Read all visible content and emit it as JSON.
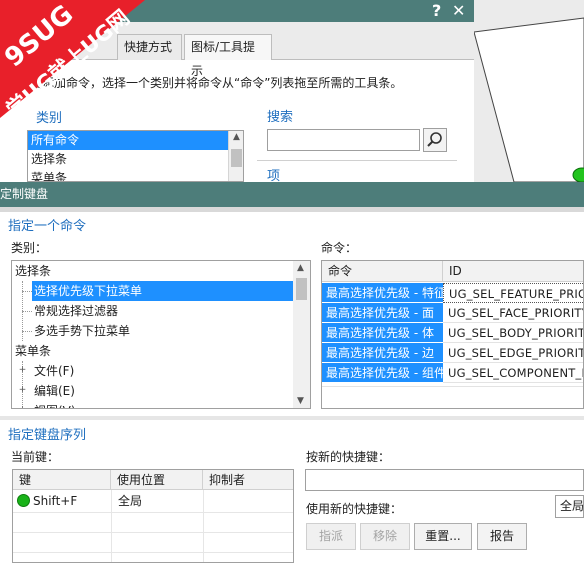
{
  "background_dialog": {
    "help_label": "?",
    "close_label": "✕",
    "tabs": [
      "快捷方式",
      "图标/工具提示"
    ],
    "instruction": "要添加命令，选择一个类别并将命令从“命令”列表拖至所需的工具条。",
    "category_label": "类别",
    "category_items": [
      "所有命令",
      "选择条",
      "菜单条"
    ],
    "search_label": "搜索",
    "items_label": "项"
  },
  "watermark": {
    "line1": "9SUG",
    "line2": "学UG就上UG网"
  },
  "dialog": {
    "title": "定制键盘",
    "section_command": "指定一个命令",
    "category_label": "类别：",
    "command_label": "命令：",
    "category_tree": [
      {
        "label": "选择条",
        "level": 0,
        "expander": ""
      },
      {
        "label": "选择优先级下拉菜单",
        "level": 1,
        "expander": "",
        "selected": true
      },
      {
        "label": "常规选择过滤器",
        "level": 1,
        "expander": ""
      },
      {
        "label": "多选手势下拉菜单",
        "level": 1,
        "expander": ""
      },
      {
        "label": "菜单条",
        "level": 0,
        "expander": ""
      },
      {
        "label": "文件(F)",
        "level": 1,
        "expander": "+"
      },
      {
        "label": "编辑(E)",
        "level": 1,
        "expander": "+"
      },
      {
        "label": "视图(V)",
        "level": 1,
        "expander": "+"
      }
    ],
    "command_columns": [
      "命令",
      "ID"
    ],
    "commands": [
      {
        "name": "最高选择优先级 - 特征",
        "id": "UG_SEL_FEATURE_PRIORITY"
      },
      {
        "name": "最高选择优先级 - 面",
        "id": "UG_SEL_FACE_PRIORITY"
      },
      {
        "name": "最高选择优先级 - 体",
        "id": "UG_SEL_BODY_PRIORITY"
      },
      {
        "name": "最高选择优先级 - 边",
        "id": "UG_SEL_EDGE_PRIORITY"
      },
      {
        "name": "最高选择优先级 - 组件",
        "id": "UG_SEL_COMPONENT_PRIORITY"
      }
    ],
    "section_keys": "指定键盘序列",
    "current_keys_label": "当前键：",
    "key_columns": [
      "键",
      "使用位置",
      "抑制者"
    ],
    "key_rows": [
      {
        "key": "Shift+F",
        "location": "全局",
        "suppressed_by": ""
      }
    ],
    "new_shortcut_label": "按新的快捷键：",
    "new_shortcut_value": "",
    "use_new_shortcut_label": "使用新的快捷键：",
    "use_location": "全局",
    "buttons": {
      "assign": "指派",
      "remove": "移除",
      "reset": "重置...",
      "report": "报告"
    }
  },
  "colors": {
    "titlebar": "#4d7d7a",
    "selection": "#1e90ff",
    "section_title": "#1f6fbf",
    "watermark_red": "#e8202a"
  }
}
